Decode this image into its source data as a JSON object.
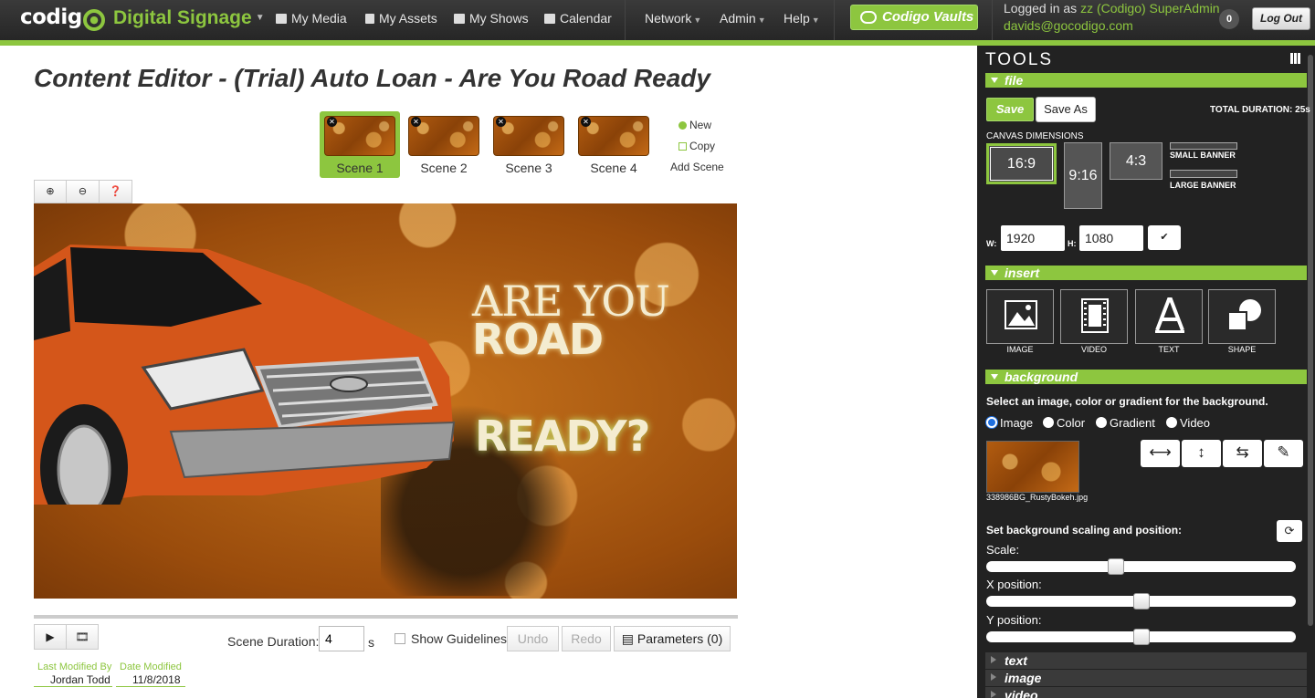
{
  "nav": {
    "logo": "codigo",
    "app_name": "Digital Signage",
    "links": [
      {
        "label": "My Media"
      },
      {
        "label": "My Assets"
      },
      {
        "label": "My Shows"
      },
      {
        "label": "Calendar"
      }
    ],
    "menus": [
      {
        "label": "Network"
      },
      {
        "label": "Admin"
      },
      {
        "label": "Help"
      }
    ],
    "vaults": "Codigo Vaults",
    "logged_in_prefix": "Logged in as",
    "user": "zz (Codigo) SuperAdmin",
    "email": "davids@gocodigo.com",
    "notifications": "0",
    "logout": "Log Out"
  },
  "editor": {
    "title": "Content Editor - (Trial) Auto Loan - Are You Road Ready",
    "scenes": [
      {
        "label": "Scene 1",
        "active": true
      },
      {
        "label": "Scene 2",
        "active": false
      },
      {
        "label": "Scene 3",
        "active": false
      },
      {
        "label": "Scene 4",
        "active": false
      }
    ],
    "new_label": "New",
    "copy_label": "Copy",
    "add_scene_label": "Add Scene",
    "canvas_text": {
      "line1": "ARE YOU",
      "line2": "ROAD",
      "line3": "READY?"
    },
    "scene_duration_label": "Scene Duration:",
    "scene_duration_value": "4",
    "scene_duration_unit": "s",
    "show_guidelines": "Show Guidelines",
    "undo": "Undo",
    "redo": "Redo",
    "parameters": "Parameters (0)",
    "last_modified_by_label": "Last Modified By",
    "last_modified_by": "Jordan Todd",
    "date_modified_label": "Date Modified",
    "date_modified": "11/8/2018"
  },
  "tools": {
    "title": "TOOLS",
    "file": {
      "header": "file",
      "save": "Save",
      "save_as": "Save As",
      "total_duration": "TOTAL DURATION: 25s",
      "canvas_dimensions": "CANVAS DIMENSIONS",
      "ratios": [
        "16:9",
        "9:16",
        "4:3"
      ],
      "selected_ratio": "16:9",
      "small_banner": "SMALL BANNER",
      "large_banner": "LARGE BANNER",
      "w_label": "W:",
      "h_label": "H:",
      "width": "1920",
      "height": "1080"
    },
    "insert": {
      "header": "insert",
      "items": [
        "IMAGE",
        "VIDEO",
        "TEXT",
        "SHAPE"
      ]
    },
    "background": {
      "header": "background",
      "instructions": "Select an image, color or gradient for the background.",
      "options": [
        "Image",
        "Color",
        "Gradient",
        "Video"
      ],
      "selected": "Image",
      "filename": "338986BG_RustyBokeh.jpg",
      "scaling_label": "Set background scaling and position:",
      "scale_label": "Scale:",
      "x_label": "X position:",
      "y_label": "Y position:",
      "scale_value": 0.42,
      "x_value": 0.5,
      "y_value": 0.5
    },
    "collapsed_sections": [
      "text",
      "image",
      "video"
    ]
  }
}
